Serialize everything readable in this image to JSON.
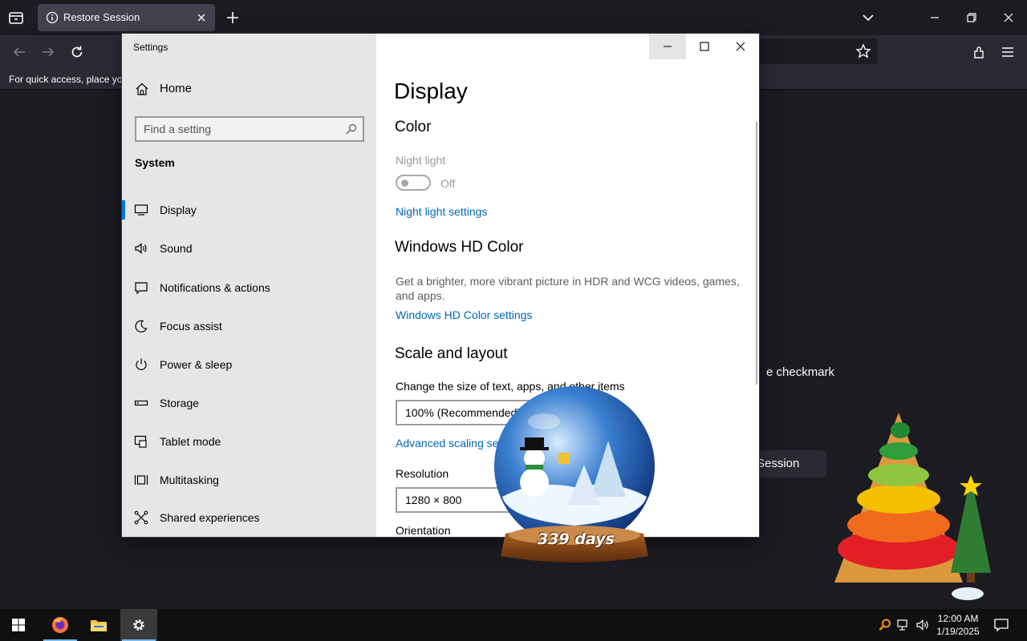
{
  "browser": {
    "tab_title": "Restore Session",
    "bookmark_text": "For quick access, place you"
  },
  "page_background": {
    "partial_text": "e checkmark",
    "partial_button": "w Session"
  },
  "settings": {
    "window_title": "Settings",
    "home_label": "Home",
    "search_placeholder": "Find a setting",
    "section_heading": "System",
    "nav_items": [
      {
        "label": "Display",
        "icon": "monitor-icon",
        "selected": true
      },
      {
        "label": "Sound",
        "icon": "speaker-icon",
        "selected": false
      },
      {
        "label": "Notifications & actions",
        "icon": "notification-icon",
        "selected": false
      },
      {
        "label": "Focus assist",
        "icon": "moon-icon",
        "selected": false
      },
      {
        "label": "Power & sleep",
        "icon": "power-icon",
        "selected": false
      },
      {
        "label": "Storage",
        "icon": "storage-icon",
        "selected": false
      },
      {
        "label": "Tablet mode",
        "icon": "tablet-icon",
        "selected": false
      },
      {
        "label": "Multitasking",
        "icon": "multitasking-icon",
        "selected": false
      },
      {
        "label": "Shared experiences",
        "icon": "shared-experiences-icon",
        "selected": false
      }
    ],
    "content": {
      "page_title": "Display",
      "color_heading": "Color",
      "night_light_label": "Night light",
      "night_light_state": "Off",
      "night_light_settings_link": "Night light settings",
      "hd_color_heading": "Windows HD Color",
      "hd_color_desc": "Get a brighter, more vibrant picture in HDR and WCG videos, games, and apps.",
      "hd_color_link": "Windows HD Color settings",
      "scale_heading": "Scale and layout",
      "scale_desc": "Change the size of text, apps, and other items",
      "scale_value": "100% (Recommended)",
      "advanced_scaling_link": "Advanced scaling settings",
      "resolution_label": "Resolution",
      "resolution_value": "1280 × 800",
      "orientation_label": "Orientation"
    }
  },
  "widget": {
    "days_text": "339 days"
  },
  "taskbar": {
    "time": "12:00 AM",
    "date": "1/19/2025"
  },
  "colors": {
    "accent": "#0078d7",
    "link": "#0067b8",
    "browser_bg": "#1c1b22"
  }
}
